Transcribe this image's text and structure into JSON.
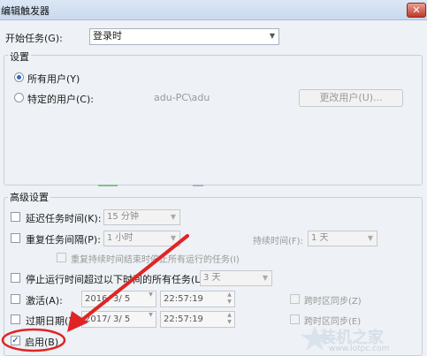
{
  "window": {
    "title": "编辑触发器",
    "close_glyph": "✕"
  },
  "start_task": {
    "label": "开始任务(G):",
    "value": "登录时"
  },
  "settings": {
    "group_label": "设置",
    "radio_all_users": "所有用户(Y)",
    "radio_specific_user": "特定的用户(C):",
    "user_name": "adu-PC\\adu",
    "change_user_button": "更改用户(U)..."
  },
  "advanced": {
    "group_label": "高级设置",
    "delay": {
      "label": "延迟任务时间(K):",
      "value": "15 分钟"
    },
    "repeat": {
      "label": "重复任务间隔(P):",
      "value": "1 小时",
      "duration_label": "持续时间(F):",
      "duration_value": "1 天"
    },
    "stop_all": {
      "label": "重复持续时间结束时停止所有运行的任务(I)"
    },
    "stop_if_longer": {
      "label": "停止运行时间超过以下时间的所有任务(L):",
      "value": "3 天"
    },
    "activate": {
      "label": "激活(A):",
      "date": "2016/ 3/ 5",
      "time": "22:57:19",
      "sync_label": "跨时区同步(Z)"
    },
    "expire": {
      "label": "过期日期(X):",
      "date": "2017/ 3/ 5",
      "time": "22:57:19",
      "sync_label": "跨时区同步(E)"
    },
    "enabled": {
      "label": "启用(B)",
      "checked": true
    }
  },
  "watermark": {
    "site": "www.lotpc.com",
    "brand": "装机之家"
  },
  "colors": {
    "annotation_red": "#e02424",
    "accent_blue": "#2b6cc4"
  }
}
